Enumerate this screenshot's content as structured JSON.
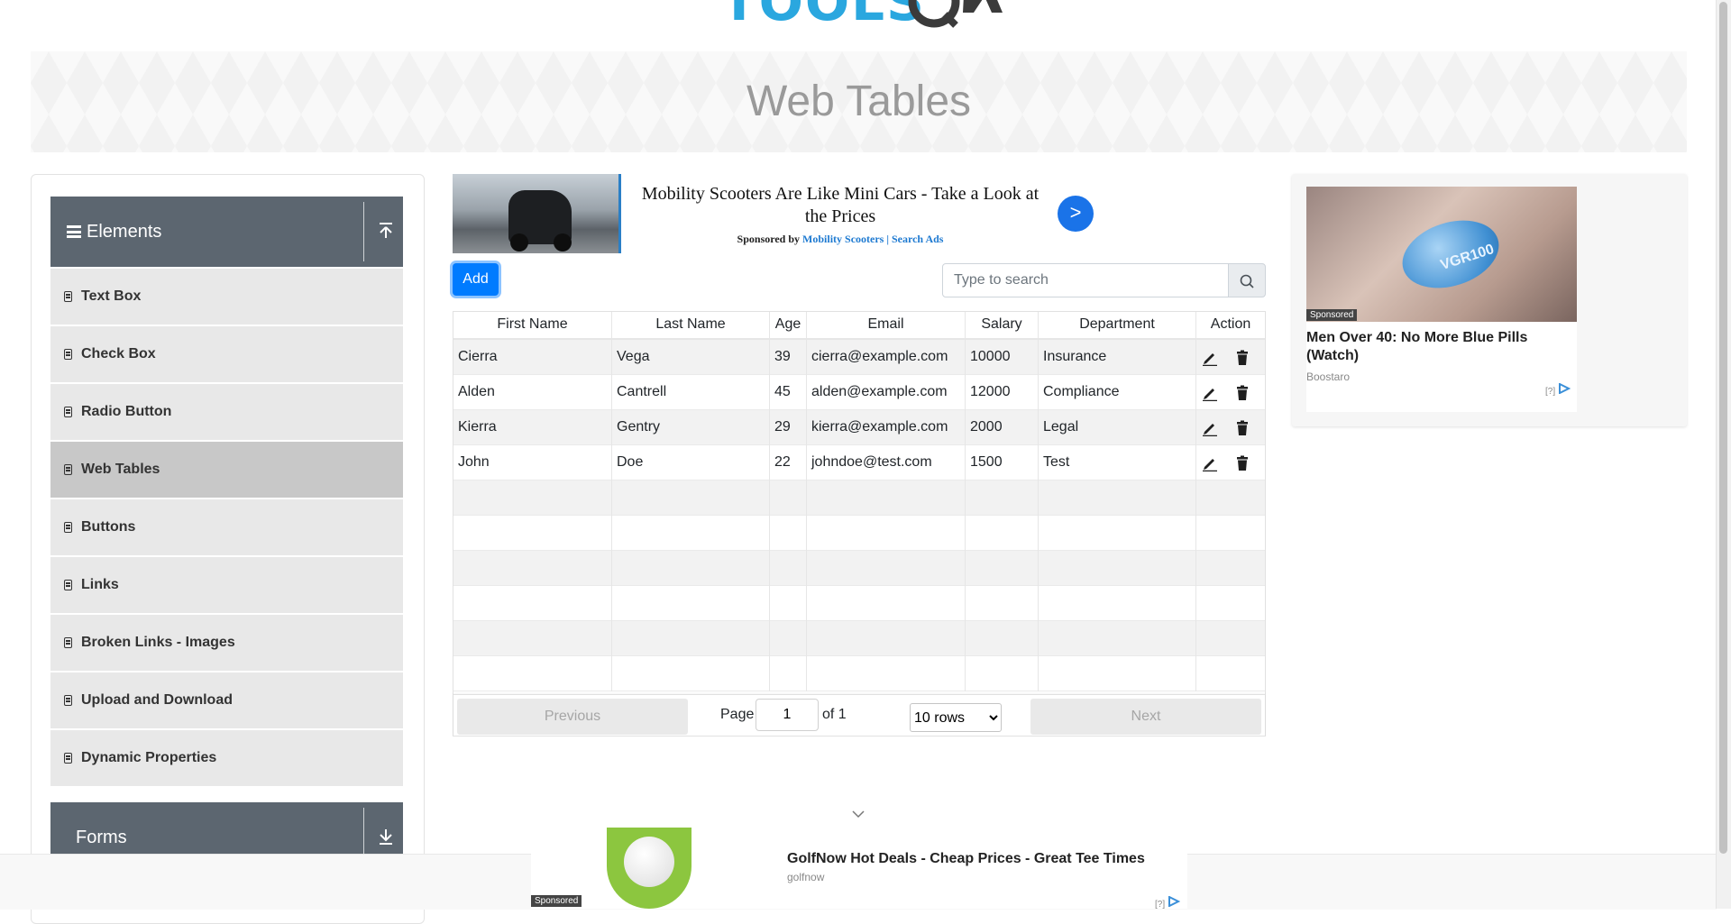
{
  "logo": {
    "text": "TOOLS",
    "q": "QA"
  },
  "banner": {
    "title": "Web Tables"
  },
  "sidebar": {
    "groups": [
      {
        "label": "Elements",
        "expanded": true
      },
      {
        "label": "Forms",
        "expanded": false
      }
    ],
    "items": [
      {
        "label": "Text Box"
      },
      {
        "label": "Check Box"
      },
      {
        "label": "Radio Button"
      },
      {
        "label": "Web Tables",
        "active": true
      },
      {
        "label": "Buttons"
      },
      {
        "label": "Links"
      },
      {
        "label": "Broken Links - Images"
      },
      {
        "label": "Upload and Download"
      },
      {
        "label": "Dynamic Properties"
      }
    ]
  },
  "top_ad": {
    "title": "Mobility Scooters Are Like Mini Cars - Take a Look at the Prices",
    "sponsored_prefix": "Sponsored by",
    "sponsor_link": "Mobility Scooters | Search Ads",
    "go_label": ">"
  },
  "controls": {
    "add_label": "Add",
    "search_placeholder": "Type to search"
  },
  "table": {
    "headers": [
      "First Name",
      "Last Name",
      "Age",
      "Email",
      "Salary",
      "Department",
      "Action"
    ],
    "rows": [
      {
        "first": "Cierra",
        "last": "Vega",
        "age": "39",
        "email": "cierra@example.com",
        "salary": "10000",
        "dept": "Insurance"
      },
      {
        "first": "Alden",
        "last": "Cantrell",
        "age": "45",
        "email": "alden@example.com",
        "salary": "12000",
        "dept": "Compliance"
      },
      {
        "first": "Kierra",
        "last": "Gentry",
        "age": "29",
        "email": "kierra@example.com",
        "salary": "2000",
        "dept": "Legal"
      },
      {
        "first": "John",
        "last": "Doe",
        "age": "22",
        "email": "johndoe@test.com",
        "salary": "1500",
        "dept": "Test"
      }
    ],
    "empty_rows": 6
  },
  "pagination": {
    "previous": "Previous",
    "page_label": "Page",
    "page_value": "1",
    "of_label": "of 1",
    "rows_option": "10 rows",
    "next": "Next"
  },
  "right_ad": {
    "pill_text": "VGR100",
    "sponsored": "Sponsored",
    "headline": "Men Over 40: No More Blue Pills (Watch)",
    "brand": "Boostaro",
    "adchoice": "[?]"
  },
  "bottom_ad": {
    "sponsored": "Sponsored",
    "headline": "GolfNow Hot Deals - Cheap Prices - Great Tee Times",
    "brand": "golfnow",
    "adchoice": "[?]"
  },
  "colors": {
    "accent": "#007bff",
    "sidebar_header": "#5c6670",
    "logo_blue": "#2aa7df"
  },
  "icons": [
    "hamburger-icon",
    "collapse-up-icon",
    "expand-down-icon",
    "document-icon",
    "search-icon",
    "edit-pencil-icon",
    "trash-icon",
    "adchoices-icon",
    "chevron-down-icon"
  ]
}
